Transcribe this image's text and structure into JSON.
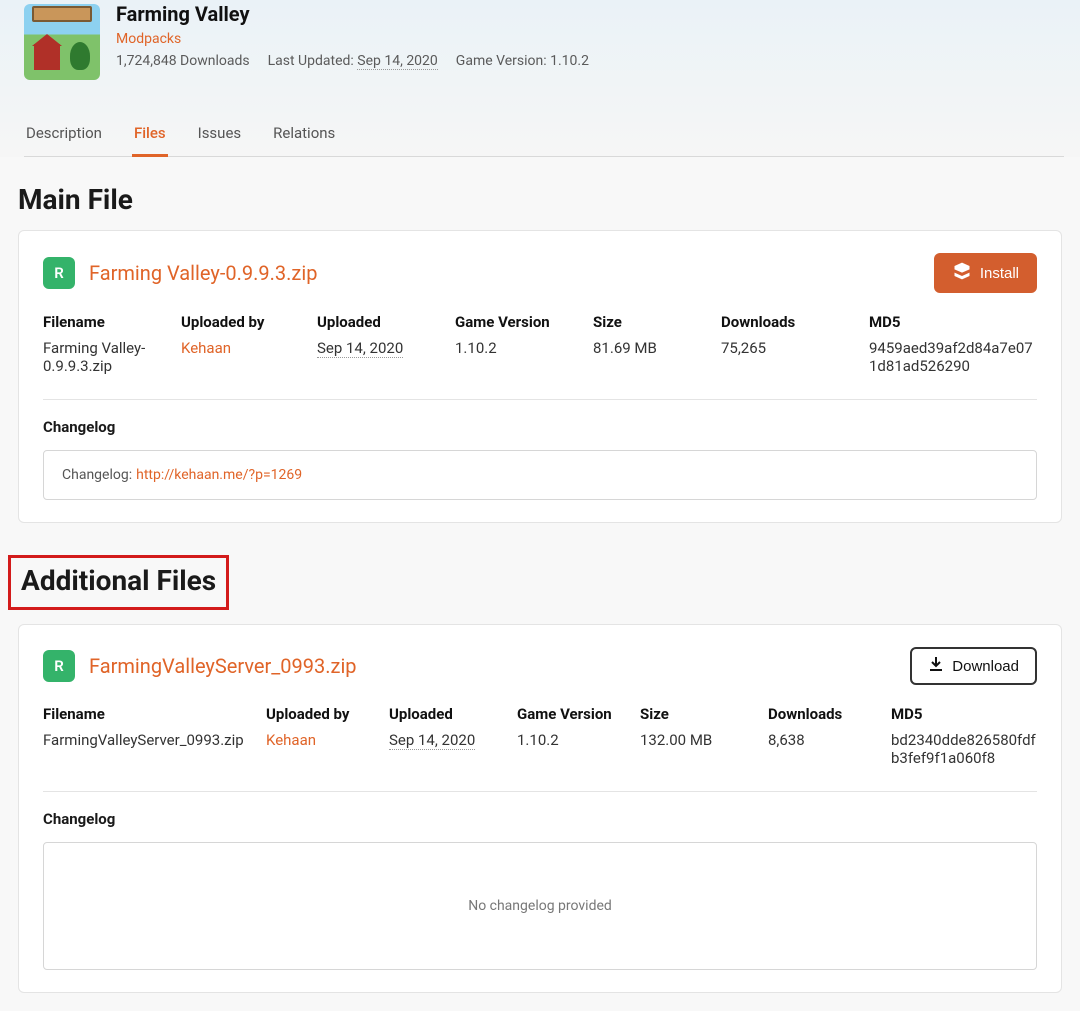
{
  "header": {
    "title": "Farming Valley",
    "category": "Modpacks",
    "downloads": "1,724,848 Downloads",
    "updated_label": "Last Updated:",
    "updated_value": "Sep 14, 2020",
    "gameversion_label": "Game Version:",
    "gameversion_value": "1.10.2"
  },
  "tabs": {
    "description": "Description",
    "files": "Files",
    "issues": "Issues",
    "relations": "Relations"
  },
  "sections": {
    "main": "Main File",
    "additional": "Additional Files"
  },
  "columns": {
    "filename": "Filename",
    "uploaded_by": "Uploaded by",
    "uploaded": "Uploaded",
    "game_version": "Game Version",
    "size": "Size",
    "downloads": "Downloads",
    "md5": "MD5",
    "changelog": "Changelog"
  },
  "buttons": {
    "install": "Install",
    "download": "Download"
  },
  "badge": {
    "release": "R"
  },
  "main_file": {
    "link": "Farming Valley-0.9.9.3.zip",
    "filename": "Farming Valley-0.9.9.3.zip",
    "uploaded_by": "Kehaan",
    "uploaded": "Sep 14, 2020",
    "game_version": "1.10.2",
    "size": "81.69 MB",
    "downloads": "75,265",
    "md5": "9459aed39af2d84a7e071d81ad526290",
    "changelog_prefix": "Changelog:",
    "changelog_link": "http://kehaan.me/?p=1269"
  },
  "additional_file": {
    "link": "FarmingValleyServer_0993.zip",
    "filename": "FarmingValleyServer_0993.zip",
    "uploaded_by": "Kehaan",
    "uploaded": "Sep 14, 2020",
    "game_version": "1.10.2",
    "size": "132.00 MB",
    "downloads": "8,638",
    "md5": "bd2340dde826580fdfb3fef9f1a060f8",
    "changelog_empty": "No changelog provided"
  }
}
